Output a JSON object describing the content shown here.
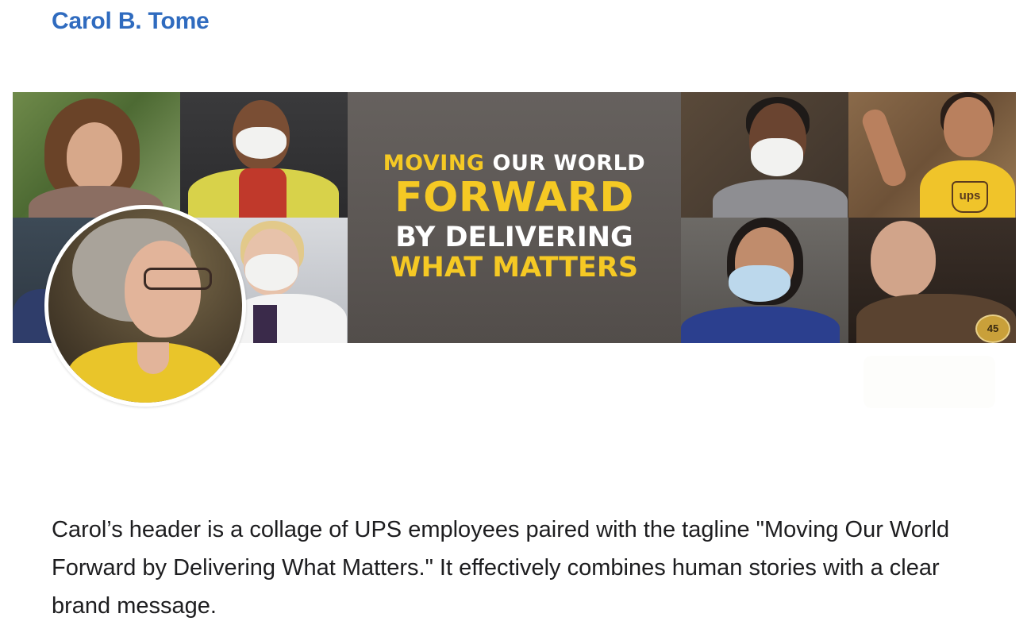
{
  "header": {
    "name_link": "Carol B. Tome"
  },
  "banner": {
    "tagline": {
      "line1_yellow": "MOVING",
      "line1_white": " OUR WORLD",
      "line2": "FORWARD",
      "line3": "BY DELIVERING",
      "line4": "WHAT MATTERS"
    },
    "badges": {
      "ups_shirt": "ups",
      "pin_number": "45"
    }
  },
  "caption": {
    "text": "Carol’s header is a collage of UPS employees paired with the tagline \"Moving Our World Forward by Delivering What Matters.\" It effectively combines human stories with a clear brand message."
  },
  "colors": {
    "link": "#2f6bbf",
    "brand_yellow": "#f5c924",
    "panel_gray": "#5e5956"
  }
}
